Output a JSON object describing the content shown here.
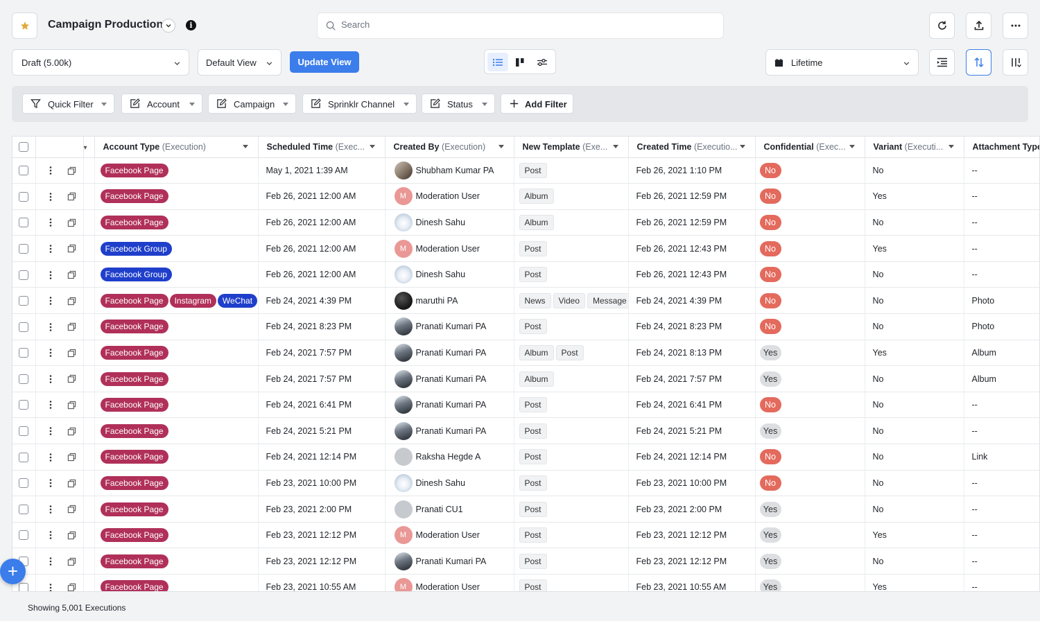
{
  "header": {
    "title": "Campaign Production",
    "search_placeholder": "Search"
  },
  "toolbar": {
    "view_dropdown": "Draft (5.00k)",
    "default_view": "Default View",
    "update_view": "Update View",
    "date_range": "Lifetime"
  },
  "filters": [
    {
      "label": "Quick Filter",
      "icon": "funnel-icon"
    },
    {
      "label": "Account",
      "icon": "edit-icon"
    },
    {
      "label": "Campaign",
      "icon": "edit-icon"
    },
    {
      "label": "Sprinklr Channel",
      "icon": "edit-icon"
    },
    {
      "label": "Status",
      "icon": "edit-icon"
    },
    {
      "label": "Add Filter",
      "icon": "plus-icon"
    }
  ],
  "columns": [
    {
      "label": "Account Type",
      "sub": "(Execution)"
    },
    {
      "label": "Scheduled Time",
      "sub": "(Exec..."
    },
    {
      "label": "Created By",
      "sub": "(Execution)"
    },
    {
      "label": "New Template",
      "sub": "(Exe..."
    },
    {
      "label": "Created Time",
      "sub": "(Executio..."
    },
    {
      "label": "Confidential",
      "sub": "(Exec..."
    },
    {
      "label": "Variant",
      "sub": "(Executi..."
    },
    {
      "label": "Attachment Type",
      "sub": ""
    }
  ],
  "rows": [
    {
      "account": [
        {
          "t": "Facebook Page",
          "c": "pink"
        }
      ],
      "scheduled": "May 1, 2021 1:39 AM",
      "creator": "Shubham Kumar PA",
      "avatar": "photo",
      "avatar_letter": "",
      "templates": [
        "Post"
      ],
      "created": "Feb 26, 2021 1:10 PM",
      "confidential": "No",
      "variant": "No",
      "attachment": "--"
    },
    {
      "account": [
        {
          "t": "Facebook Page",
          "c": "pink"
        }
      ],
      "scheduled": "Feb 26, 2021 12:00 AM",
      "creator": "Moderation User",
      "avatar": "m",
      "avatar_letter": "M",
      "templates": [
        "Album"
      ],
      "created": "Feb 26, 2021 12:59 PM",
      "confidential": "No",
      "variant": "Yes",
      "attachment": "--"
    },
    {
      "account": [
        {
          "t": "Facebook Page",
          "c": "pink"
        }
      ],
      "scheduled": "Feb 26, 2021 12:00 AM",
      "creator": "Dinesh Sahu",
      "avatar": "peng",
      "avatar_letter": "",
      "templates": [
        "Album"
      ],
      "created": "Feb 26, 2021 12:59 PM",
      "confidential": "No",
      "variant": "No",
      "attachment": "--"
    },
    {
      "account": [
        {
          "t": "Facebook Group",
          "c": "blue"
        }
      ],
      "scheduled": "Feb 26, 2021 12:00 AM",
      "creator": "Moderation User",
      "avatar": "m",
      "avatar_letter": "M",
      "templates": [
        "Post"
      ],
      "created": "Feb 26, 2021 12:43 PM",
      "confidential": "No",
      "variant": "Yes",
      "attachment": "--"
    },
    {
      "account": [
        {
          "t": "Facebook Group",
          "c": "blue"
        }
      ],
      "scheduled": "Feb 26, 2021 12:00 AM",
      "creator": "Dinesh Sahu",
      "avatar": "peng",
      "avatar_letter": "",
      "templates": [
        "Post"
      ],
      "created": "Feb 26, 2021 12:43 PM",
      "confidential": "No",
      "variant": "No",
      "attachment": "--"
    },
    {
      "account": [
        {
          "t": "Facebook Page",
          "c": "pink"
        },
        {
          "t": "Instagram",
          "c": "pink"
        },
        {
          "t": "WeChat",
          "c": "blue"
        }
      ],
      "scheduled": "Feb 24, 2021 4:39 PM",
      "creator": "maruthi PA",
      "avatar": "dark",
      "avatar_letter": "",
      "templates": [
        "News",
        "Video",
        "Message"
      ],
      "created": "Feb 24, 2021 4:39 PM",
      "confidential": "No",
      "variant": "No",
      "attachment": "Photo"
    },
    {
      "account": [
        {
          "t": "Facebook Page",
          "c": "pink"
        }
      ],
      "scheduled": "Feb 24, 2021 8:23 PM",
      "creator": "Pranati Kumari PA",
      "avatar": "eagle",
      "avatar_letter": "",
      "templates": [
        "Post"
      ],
      "created": "Feb 24, 2021 8:23 PM",
      "confidential": "No",
      "variant": "No",
      "attachment": "Photo"
    },
    {
      "account": [
        {
          "t": "Facebook Page",
          "c": "pink"
        }
      ],
      "scheduled": "Feb 24, 2021 7:57 PM",
      "creator": "Pranati Kumari PA",
      "avatar": "eagle",
      "avatar_letter": "",
      "templates": [
        "Album",
        "Post"
      ],
      "created": "Feb 24, 2021 8:13 PM",
      "confidential": "Yes",
      "variant": "Yes",
      "attachment": "Album"
    },
    {
      "account": [
        {
          "t": "Facebook Page",
          "c": "pink"
        }
      ],
      "scheduled": "Feb 24, 2021 7:57 PM",
      "creator": "Pranati Kumari PA",
      "avatar": "eagle",
      "avatar_letter": "",
      "templates": [
        "Album"
      ],
      "created": "Feb 24, 2021 7:57 PM",
      "confidential": "Yes",
      "variant": "No",
      "attachment": "Album"
    },
    {
      "account": [
        {
          "t": "Facebook Page",
          "c": "pink"
        }
      ],
      "scheduled": "Feb 24, 2021 6:41 PM",
      "creator": "Pranati Kumari PA",
      "avatar": "eagle",
      "avatar_letter": "",
      "templates": [
        "Post"
      ],
      "created": "Feb 24, 2021 6:41 PM",
      "confidential": "No",
      "variant": "No",
      "attachment": "--"
    },
    {
      "account": [
        {
          "t": "Facebook Page",
          "c": "pink"
        }
      ],
      "scheduled": "Feb 24, 2021 5:21 PM",
      "creator": "Pranati Kumari PA",
      "avatar": "eagle",
      "avatar_letter": "",
      "templates": [
        "Post"
      ],
      "created": "Feb 24, 2021 5:21 PM",
      "confidential": "Yes",
      "variant": "No",
      "attachment": "--"
    },
    {
      "account": [
        {
          "t": "Facebook Page",
          "c": "pink"
        }
      ],
      "scheduled": "Feb 24, 2021 12:14 PM",
      "creator": "Raksha Hegde A",
      "avatar": "grey",
      "avatar_letter": "",
      "templates": [
        "Post"
      ],
      "created": "Feb 24, 2021 12:14 PM",
      "confidential": "No",
      "variant": "No",
      "attachment": "Link"
    },
    {
      "account": [
        {
          "t": "Facebook Page",
          "c": "pink"
        }
      ],
      "scheduled": "Feb 23, 2021 10:00 PM",
      "creator": "Dinesh Sahu",
      "avatar": "peng",
      "avatar_letter": "",
      "templates": [
        "Post"
      ],
      "created": "Feb 23, 2021 10:00 PM",
      "confidential": "No",
      "variant": "No",
      "attachment": "--"
    },
    {
      "account": [
        {
          "t": "Facebook Page",
          "c": "pink"
        }
      ],
      "scheduled": "Feb 23, 2021 2:00 PM",
      "creator": "Pranati CU1",
      "avatar": "grey",
      "avatar_letter": "",
      "templates": [
        "Post"
      ],
      "created": "Feb 23, 2021 2:00 PM",
      "confidential": "Yes",
      "variant": "No",
      "attachment": "--"
    },
    {
      "account": [
        {
          "t": "Facebook Page",
          "c": "pink"
        }
      ],
      "scheduled": "Feb 23, 2021 12:12 PM",
      "creator": "Moderation User",
      "avatar": "m",
      "avatar_letter": "M",
      "templates": [
        "Post"
      ],
      "created": "Feb 23, 2021 12:12 PM",
      "confidential": "Yes",
      "variant": "Yes",
      "attachment": "--"
    },
    {
      "account": [
        {
          "t": "Facebook Page",
          "c": "pink"
        }
      ],
      "scheduled": "Feb 23, 2021 12:12 PM",
      "creator": "Pranati Kumari PA",
      "avatar": "eagle",
      "avatar_letter": "",
      "templates": [
        "Post"
      ],
      "created": "Feb 23, 2021 12:12 PM",
      "confidential": "Yes",
      "variant": "No",
      "attachment": "--"
    },
    {
      "account": [
        {
          "t": "Facebook Page",
          "c": "pink"
        }
      ],
      "scheduled": "Feb 23, 2021 10:55 AM",
      "creator": "Moderation User",
      "avatar": "m",
      "avatar_letter": "M",
      "templates": [
        "Post"
      ],
      "created": "Feb 23, 2021 10:55 AM",
      "confidential": "Yes",
      "variant": "Yes",
      "attachment": "--"
    }
  ],
  "footer": {
    "status": "Showing 5,001 Executions"
  },
  "fab_label": "+",
  "colors": {
    "accent": "#3b7dea",
    "badge_pink": "#b0305a",
    "badge_blue": "#1f3fcb",
    "confidential_no": "#e36a5d",
    "confidential_yes": "#dcdee2",
    "star": "#e0a93a"
  }
}
